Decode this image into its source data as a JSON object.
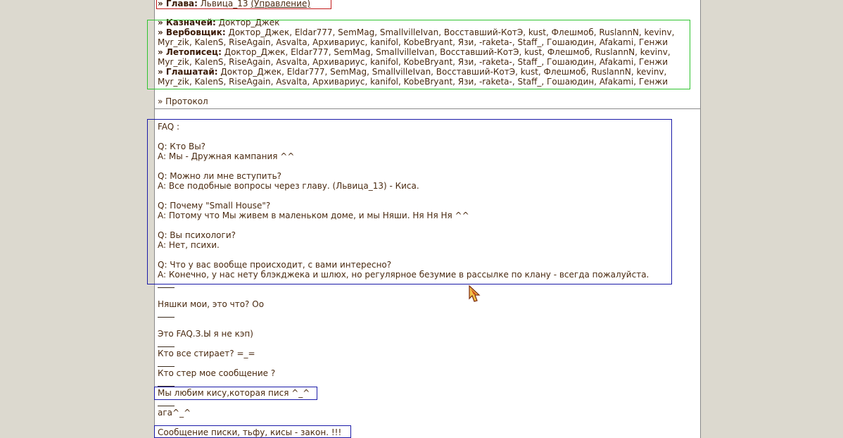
{
  "clan": {
    "head_label": "» Глава:",
    "head_value": "Львица_13",
    "manage_link": "(Управление)",
    "treasurer_label": "» Казначей:",
    "treasurer_value": "Доктор_Джек",
    "recruiter_label": "» Вербовщик:",
    "recruiter_line1": "Доктор_Джек, Eldar777, SemMag, SmallvilleIvan, Восставший-КотЭ, kust, Флешмоб, RuslannN, kevinv,",
    "recruiter_line2": "Myr_zik, KalenS, RiseAgain, Asvalta, Архивариус, kanifol, KobeBryant, Язи, -raketa-, Staff_, Гошаюдин, Afakami, Генжи",
    "chronicler_label": "» Летописец:",
    "chronicler_line1": "Доктор_Джек, Eldar777, SemMag, SmallvilleIvan, Восставший-КотЭ, kust, Флешмоб, RuslannN, kevinv,",
    "chronicler_line2": "Myr_zik, KalenS, RiseAgain, Asvalta, Архивариус, kanifol, KobeBryant, Язи, -raketa-, Staff_, Гошаюдин, Afakami, Генжи",
    "herald_label": "» Глашатай:",
    "herald_line1": "Доктор_Джек, Eldar777, SemMag, SmallvilleIvan, Восставший-КотЭ, kust, Флешмоб, RuslannN, kevinv,",
    "herald_line2": "Myr_zik, KalenS, RiseAgain, Asvalta, Архивариус, kanifol, KobeBryant, Язи, -raketa-, Staff_, Гошаюдин, Afakami, Генжи",
    "protocol_link": "» Протокол"
  },
  "faq": {
    "title": "FAQ :",
    "q1": "Q: Кто Вы?",
    "a1": "A: Мы - Дружная кампания ^^",
    "q2": "Q: Можно ли мне вступить?",
    "a2": "A: Все подобные вопросы через главу. (Львица_13) - Киса.",
    "q3": "Q: Почему \"Small House\"?",
    "a3": "A: Потому что Мы живем в маленьком доме, и мы Няши. Ня Ня Ня ^^",
    "q4": "Q: Вы психологи?",
    "a4": "A: Нет, психи.",
    "q5": "Q: Что у вас вообще происходит, с вами интересно?",
    "a5": "A: Конечно, у нас нету блэкджека и шлюх, но регулярное безумие в рассылке по клану - всегда пожалуйста."
  },
  "comments": [
    "Няшки мои, это что? Oo",
    "Это FAQ.З.Ы я не кэп)",
    "Кто все стирает? =_=",
    "Кто стер мое сообщение ?",
    "Мы любим кису,которая пися ^_^",
    "ага^_^",
    "Сообщение писки, тьфу, кисы - закон. !!!"
  ]
}
